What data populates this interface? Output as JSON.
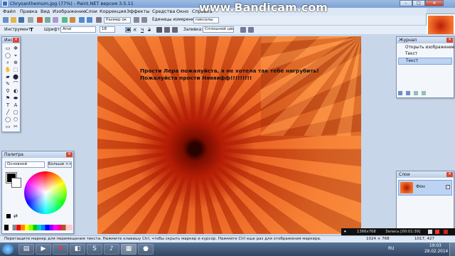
{
  "window": {
    "title": "Chrysanthemum.jpg (77%) - Paint.NET версия 3.5.11",
    "icon": "paint-net-icon"
  },
  "watermark": "www.Bandicam.com",
  "menu": [
    "Файл",
    "Правка",
    "Вид",
    "Изображение",
    "Слои",
    "Коррекция",
    "Эффекты",
    "Средства",
    "Окно",
    "Справка"
  ],
  "toolbar1": {
    "zoom_value": "Размер ок",
    "units_label": "Единицы измерения:",
    "units_value": "пикселы"
  },
  "toolbar2": {
    "tool_label": "Инструмент:",
    "font_label": "Шрифт:",
    "font_value": "Arial",
    "size_value": "18",
    "bold": "Ж",
    "italic": "К",
    "underline": "Ч",
    "strike": "З",
    "fill_label": "Заливка:",
    "fill_value": "Сплошной цвет"
  },
  "canvas": {
    "line1": "Прости Лера пожалуйста, я не хотела так тебе нагрубить!",
    "line2": "Пожалуйста прости Няяяяфф!!!!!!!!!"
  },
  "tools_window": {
    "title": "Инс...",
    "tools": [
      "▭",
      "✥",
      "◯",
      "⌖",
      "⌕",
      "⊕",
      "✋",
      "⬚",
      "▰",
      "⬤",
      "✎",
      "⌒",
      "⚲",
      "◐",
      "⚑",
      "⬬",
      "T",
      "A",
      "╱",
      "▢",
      "◯",
      "⬡",
      "▭",
      "✂"
    ]
  },
  "palette_window": {
    "title": "Палитра",
    "mode": "Основной",
    "more_button": "Больше >>"
  },
  "history_window": {
    "title": "Журнал",
    "items": [
      "Открыть изображение",
      "Текст",
      "Текст"
    ]
  },
  "layers_window": {
    "title": "Слои",
    "layer_name": "Фон"
  },
  "statusbar": {
    "hint": "Перетащите маркер для перемещения текста. Нажмите клавишу Ctrl, чтобы скрыть маркер и курсор. Нажмите Ctrl еще раз для отображения маркера.",
    "image_size": "1024 ⨯ 768",
    "cursor_pos": "1017, 427"
  },
  "bandicam_bar": {
    "resolution": "1366x768",
    "record": "Запись [00:01:39]"
  },
  "taskbar": {
    "time": "19:03",
    "date": "28.02.2014",
    "lang": "RU"
  }
}
